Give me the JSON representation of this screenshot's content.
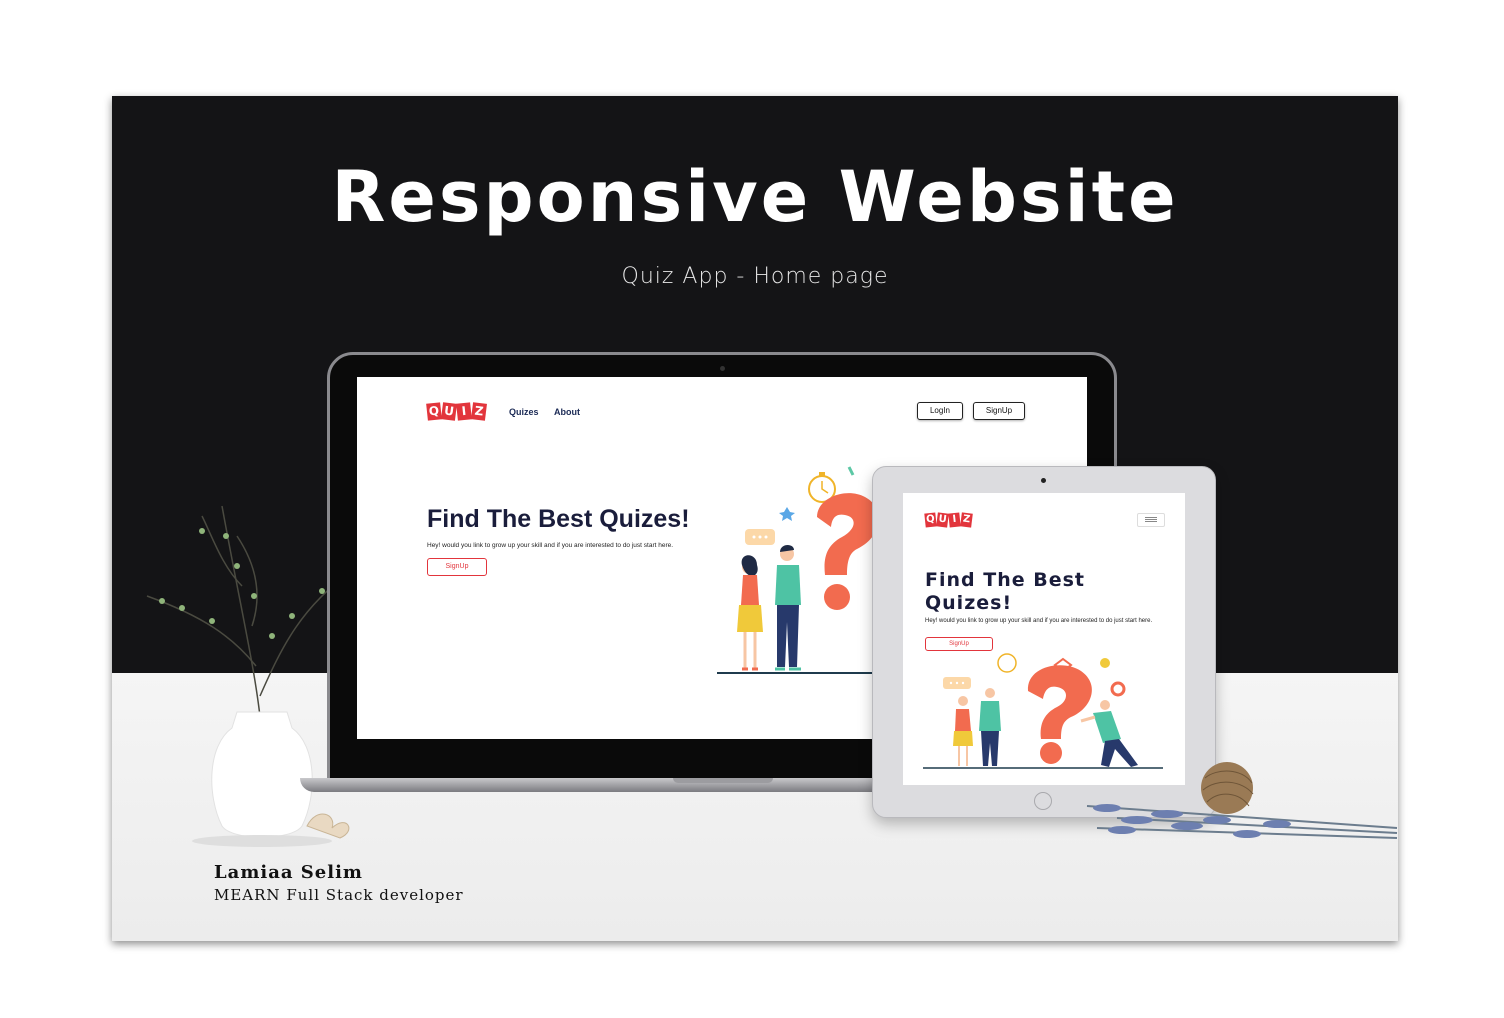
{
  "header": {
    "title": "Responsive Website",
    "subtitle": "Quiz App - Home page"
  },
  "logo_letters": [
    "Q",
    "U",
    "I",
    "Z"
  ],
  "laptop": {
    "nav": {
      "quizzes": "Quizes",
      "about": "About"
    },
    "login_label": "LogIn",
    "signup_label": "SignUp",
    "hero_title": "Find The Best Quizes!",
    "hero_text": "Hey! would you link to grow up your skill and if you are interested to do just start here.",
    "hero_button": "SignUp"
  },
  "tablet": {
    "hero_title_line1": "Find The Best",
    "hero_title_line2": "Quizes!",
    "hero_text": "Hey! would you link to grow up your skill and if you are interested to do just start here.",
    "hero_button": "SignUp"
  },
  "footer": {
    "author": "Lamiaa Selim",
    "role": "MEARN Full Stack developer"
  },
  "colors": {
    "accent": "#e2353c",
    "illustration_orange": "#f26b4f",
    "nav_text": "#1b2a55",
    "dark_bg": "#141416"
  }
}
